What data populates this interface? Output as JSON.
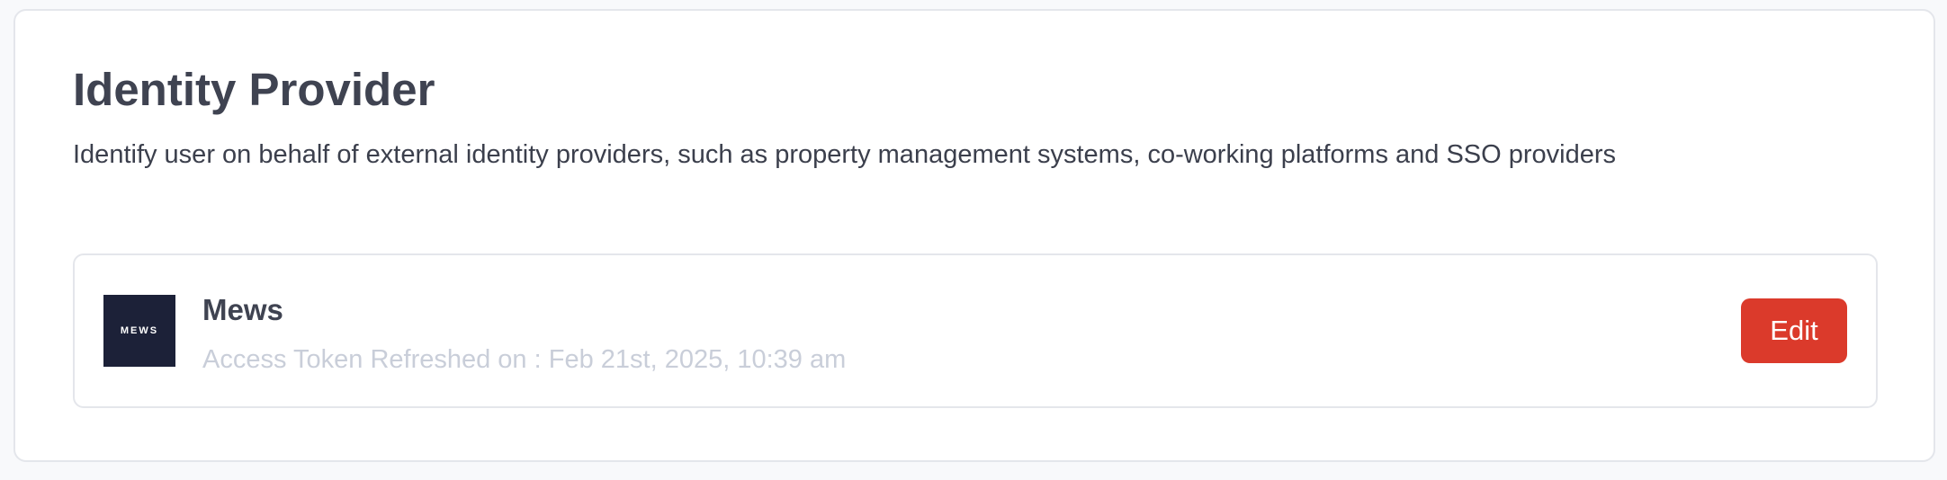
{
  "identity_provider": {
    "title": "Identity Provider",
    "description": "Identify user on behalf of external identity providers, such as property management systems, co-working platforms and SSO providers",
    "providers": [
      {
        "logo_text": "MEWS",
        "name": "Mews",
        "status": "Access Token Refreshed on : Feb 21st, 2025, 10:39 am",
        "edit_label": "Edit"
      }
    ]
  },
  "colors": {
    "accent": "#db3a2b",
    "logo_background": "#1c2138",
    "muted_text": "#c9ced9",
    "heading_text": "#3f4351"
  }
}
